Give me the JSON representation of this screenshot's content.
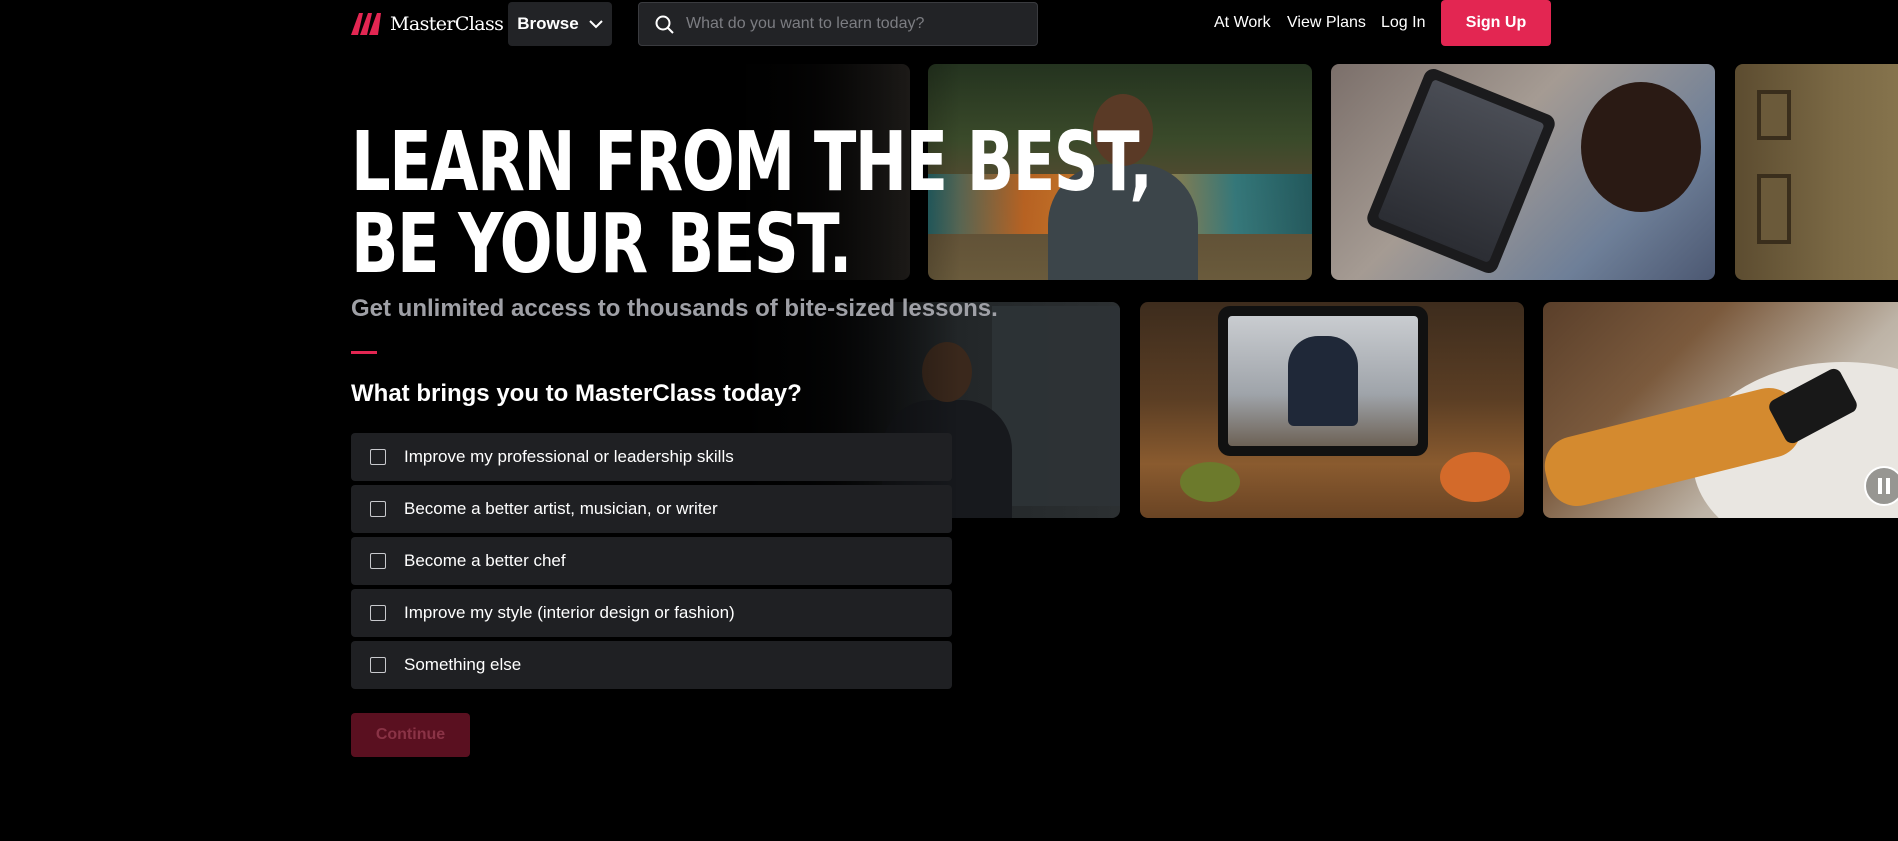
{
  "header": {
    "logo_text": "MasterClass",
    "browse_label": "Browse",
    "search_placeholder": "What do you want to learn today?",
    "nav": {
      "at_work": "At Work",
      "view_plans": "View Plans",
      "log_in": "Log In",
      "sign_up": "Sign Up"
    }
  },
  "hero": {
    "title_line1": "LEARN FROM THE BEST,",
    "title_line2": "BE YOUR BEST.",
    "subtitle": "Get unlimited access to thousands of bite-sized lessons."
  },
  "survey": {
    "question": "What brings you to MasterClass today?",
    "options": [
      "Improve my professional or leadership skills",
      "Become a better artist, musician, or writer",
      "Become a better chef",
      "Improve my style (interior design or fashion)",
      "Something else"
    ],
    "continue_label": "Continue"
  },
  "colors": {
    "brand": "#e32652",
    "background": "#000000",
    "option_bg": "#1f2023",
    "continue_disabled_bg": "#5a1020"
  }
}
